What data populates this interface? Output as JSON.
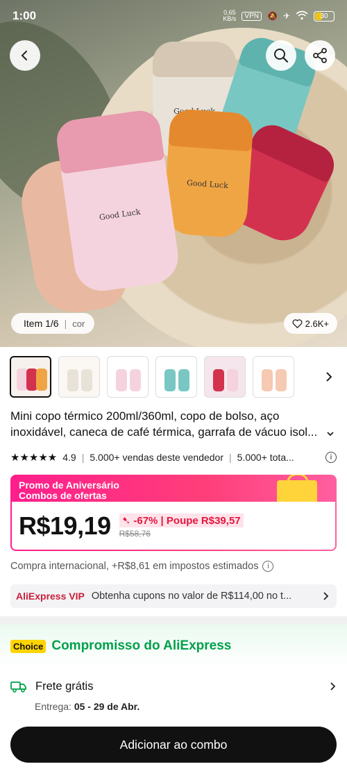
{
  "status_bar": {
    "time": "1:00",
    "speed": "0,65\nKB/s",
    "vpn": "VPN",
    "battery": "30"
  },
  "hero": {
    "bottle_text": "Good  Luck",
    "item_counter": "Item 1/6",
    "variant_label": "cor",
    "likes": "2.6K+"
  },
  "thumbnails": [
    {
      "colors": [
        "#f5d3de",
        "#d3324f",
        "#f0a544"
      ]
    },
    {
      "colors": [
        "#e8e2d8",
        "#e8e2d8"
      ]
    },
    {
      "colors": [
        "#f5d3de",
        "#f5d3de"
      ]
    },
    {
      "colors": [
        "#79c7c3",
        "#79c7c3"
      ]
    },
    {
      "colors": [
        "#d3324f",
        "#f5d3de"
      ]
    },
    {
      "colors": [
        "#f5c9b2",
        "#f5c9b2"
      ]
    }
  ],
  "product": {
    "title": "Mini copo térmico 200ml/360ml, copo de bolso, aço inoxidável, caneca de café térmica, garrafa de vácuo isol...",
    "rating": "4.9",
    "sales": "5.000+ vendas deste vendedor",
    "sales_total": "5.000+ tota..."
  },
  "promo": {
    "line1": "Promo de Aniversário",
    "line2": "Combos de ofertas",
    "price": "R$19,19",
    "discount": "-67% | Poupe R$39,57",
    "old_price": "R$58,76",
    "accent": "#ff1e8c"
  },
  "tax_note": "Compra internacional, +R$8,61 em impostos estimados",
  "vip": {
    "brand": "AliExpress",
    "brand_suffix": " VIP",
    "text": "Obtenha cupons no valor de R$114,00 no t..."
  },
  "choice": {
    "badge": "Choice",
    "title": "Compromisso do AliExpress",
    "accent": "#00a04a"
  },
  "shipping": {
    "label": "Frete grátis",
    "delivery_prefix": "Entrega:",
    "delivery_dates": "05 - 29 de Abr."
  },
  "cta": {
    "label": "Adicionar ao combo"
  }
}
